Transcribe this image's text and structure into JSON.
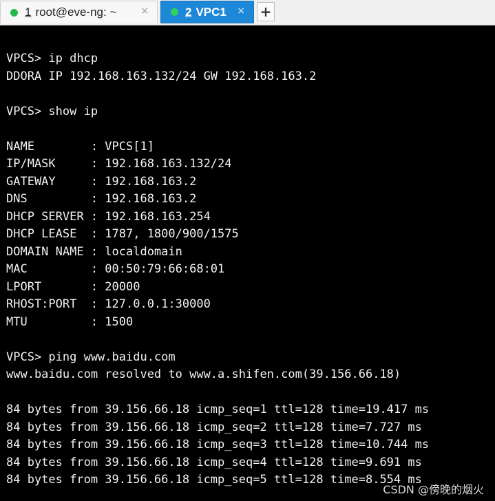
{
  "tabs": [
    {
      "number": "1",
      "title": "root@eve-ng: ~",
      "close": "×"
    },
    {
      "number": "2",
      "title": "VPC1",
      "close": "×"
    }
  ],
  "new_tab_label": "+",
  "terminal": {
    "lines": [
      "VPCS> ip dhcp",
      "DDORA IP 192.168.163.132/24 GW 192.168.163.2",
      "",
      "VPCS> show ip",
      "",
      "NAME        : VPCS[1]",
      "IP/MASK     : 192.168.163.132/24",
      "GATEWAY     : 192.168.163.2",
      "DNS         : 192.168.163.2",
      "DHCP SERVER : 192.168.163.254",
      "DHCP LEASE  : 1787, 1800/900/1575",
      "DOMAIN NAME : localdomain",
      "MAC         : 00:50:79:66:68:01",
      "LPORT       : 20000",
      "RHOST:PORT  : 127.0.0.1:30000",
      "MTU         : 1500",
      "",
      "VPCS> ping www.baidu.com",
      "www.baidu.com resolved to www.a.shifen.com(39.156.66.18)",
      "",
      "84 bytes from 39.156.66.18 icmp_seq=1 ttl=128 time=19.417 ms",
      "84 bytes from 39.156.66.18 icmp_seq=2 ttl=128 time=7.727 ms",
      "84 bytes from 39.156.66.18 icmp_seq=3 ttl=128 time=10.744 ms",
      "84 bytes from 39.156.66.18 icmp_seq=4 ttl=128 time=9.691 ms",
      "84 bytes from 39.156.66.18 icmp_seq=5 ttl=128 time=8.554 ms"
    ]
  },
  "watermark": "CSDN @傍晚的烟火",
  "colors": {
    "active_tab": "#1e88d8",
    "status_dot": "#22b84a",
    "terminal_bg": "#000000",
    "terminal_fg": "#f2f2f2"
  }
}
